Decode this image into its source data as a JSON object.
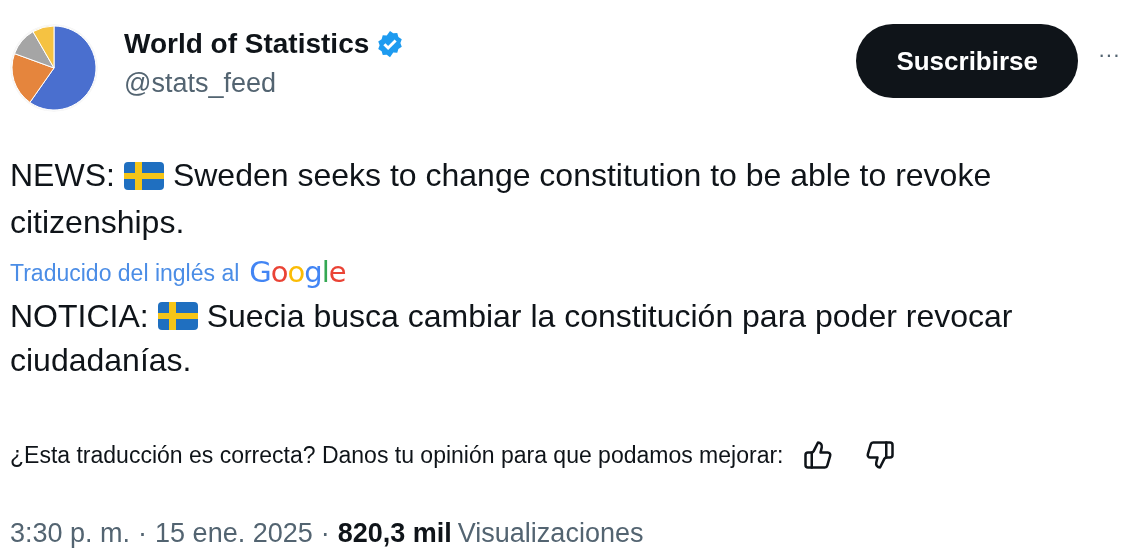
{
  "account": {
    "name": "World of Statistics",
    "verified": true,
    "handle": "@stats_feed",
    "subscribe_button": "Suscribirse",
    "more": "···"
  },
  "post": {
    "prefix": "NEWS:",
    "lines": [
      "Sweden seeks to change constitution to be able to revoke",
      "citizenships."
    ]
  },
  "translation": {
    "label": "Traducido del inglés al",
    "brand": "Google",
    "prefix": "NOTICIA:",
    "lines": [
      "Suecia busca cambiar la constitución para poder revocar",
      "ciudadanías."
    ]
  },
  "feedback": {
    "question": "¿Esta traducción es correcta? Danos tu opinión para que podamos mejorar:"
  },
  "meta": {
    "time": "3:30 p. m.",
    "separator_1": "·",
    "date": "15 ene. 2025",
    "separator_2": "·",
    "views_count": "820,3 mil",
    "views_label": "Visualizaciones"
  }
}
